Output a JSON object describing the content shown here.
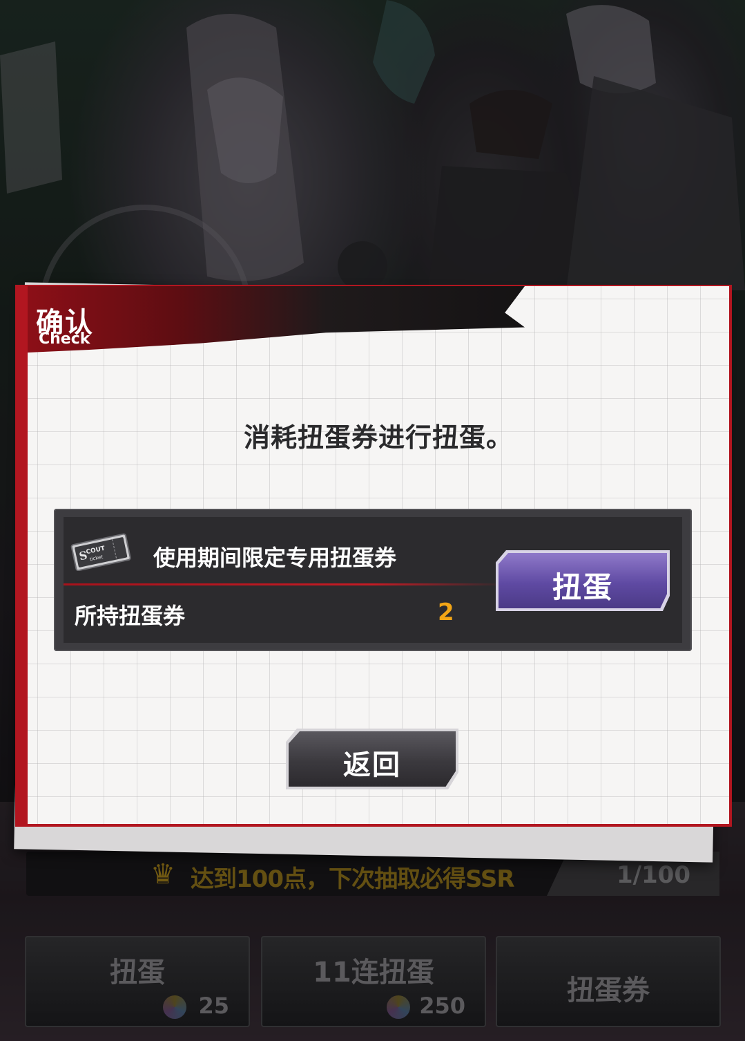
{
  "dialog": {
    "title_cn": "确认",
    "title_en": "Check",
    "message": "消耗扭蛋券进行扭蛋。",
    "ticket": {
      "icon": "scout-ticket-icon",
      "icon_text_1": "COUT",
      "icon_text_2": "ticket",
      "name": "使用期间限定专用扭蛋券",
      "owned_label": "所持扭蛋券",
      "owned_count": "2",
      "gacha_button": "扭蛋"
    },
    "back_button": "返回"
  },
  "pity": {
    "icon": "crown-icon",
    "text": "达到100点，下次抽取必得SSR",
    "count": "1/100"
  },
  "bottom_buttons": [
    {
      "label": "扭蛋",
      "cost": "25"
    },
    {
      "label": "11连扭蛋",
      "cost": "250"
    },
    {
      "label": "扭蛋券"
    }
  ],
  "colors": {
    "accent_red": "#b21620",
    "count_orange": "#f2a516",
    "gacha_purple": "#5f4aa3"
  }
}
